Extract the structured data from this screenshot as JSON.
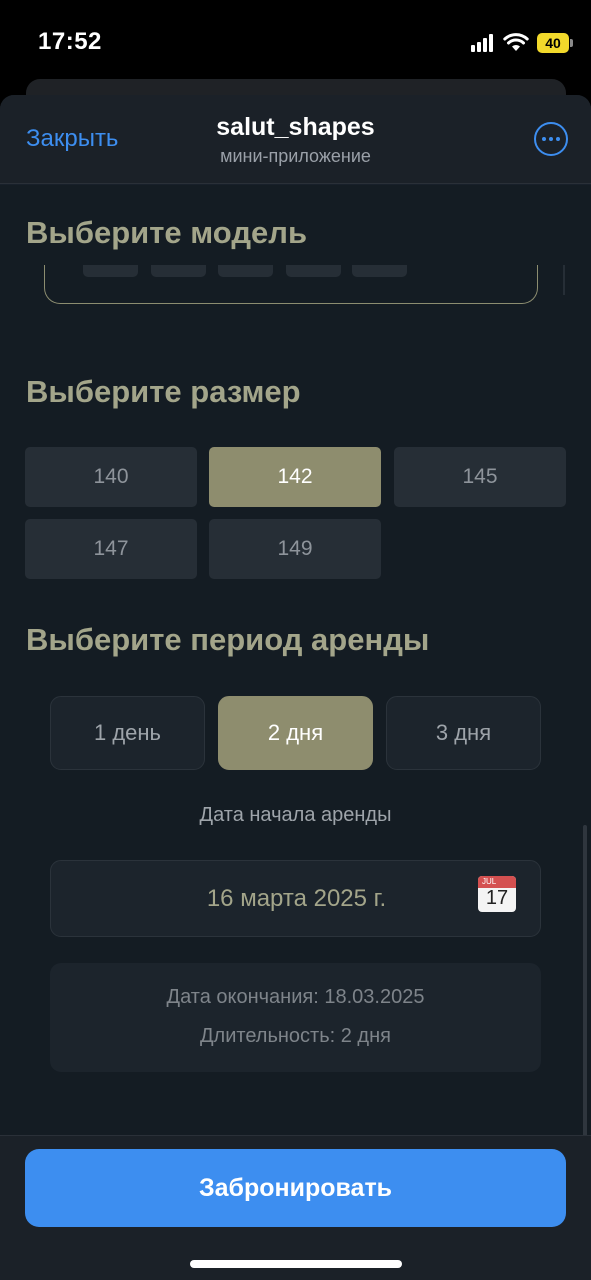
{
  "status_bar": {
    "time": "17:52",
    "battery": "40"
  },
  "header": {
    "close_label": "Закрыть",
    "title": "salut_shapes",
    "subtitle": "мини-приложение",
    "more_icon": "ellipsis-circle-icon"
  },
  "model_section": {
    "title": "Выберите модель"
  },
  "size_section": {
    "title": "Выберите размер",
    "options": [
      "140",
      "142",
      "145",
      "147",
      "149"
    ],
    "selected": "142"
  },
  "period_section": {
    "title": "Выберите период аренды",
    "options": [
      "1 день",
      "2 дня",
      "3 дня"
    ],
    "selected": "2 дня",
    "start_label": "Дата начала аренды",
    "start_date": "16 марта 2025 г.",
    "calendar_icon": "calendar-icon",
    "calendar_month": "JUL",
    "calendar_day": "17",
    "end_date_text": "Дата окончания: 18.03.2025",
    "duration_text": "Длительность: 2 дня"
  },
  "footer": {
    "book_label": "Забронировать"
  },
  "colors": {
    "accent": "#3d8ef0",
    "selected": "#8e8d6e",
    "section_title": "#a3a58a",
    "background": "#141c23"
  }
}
